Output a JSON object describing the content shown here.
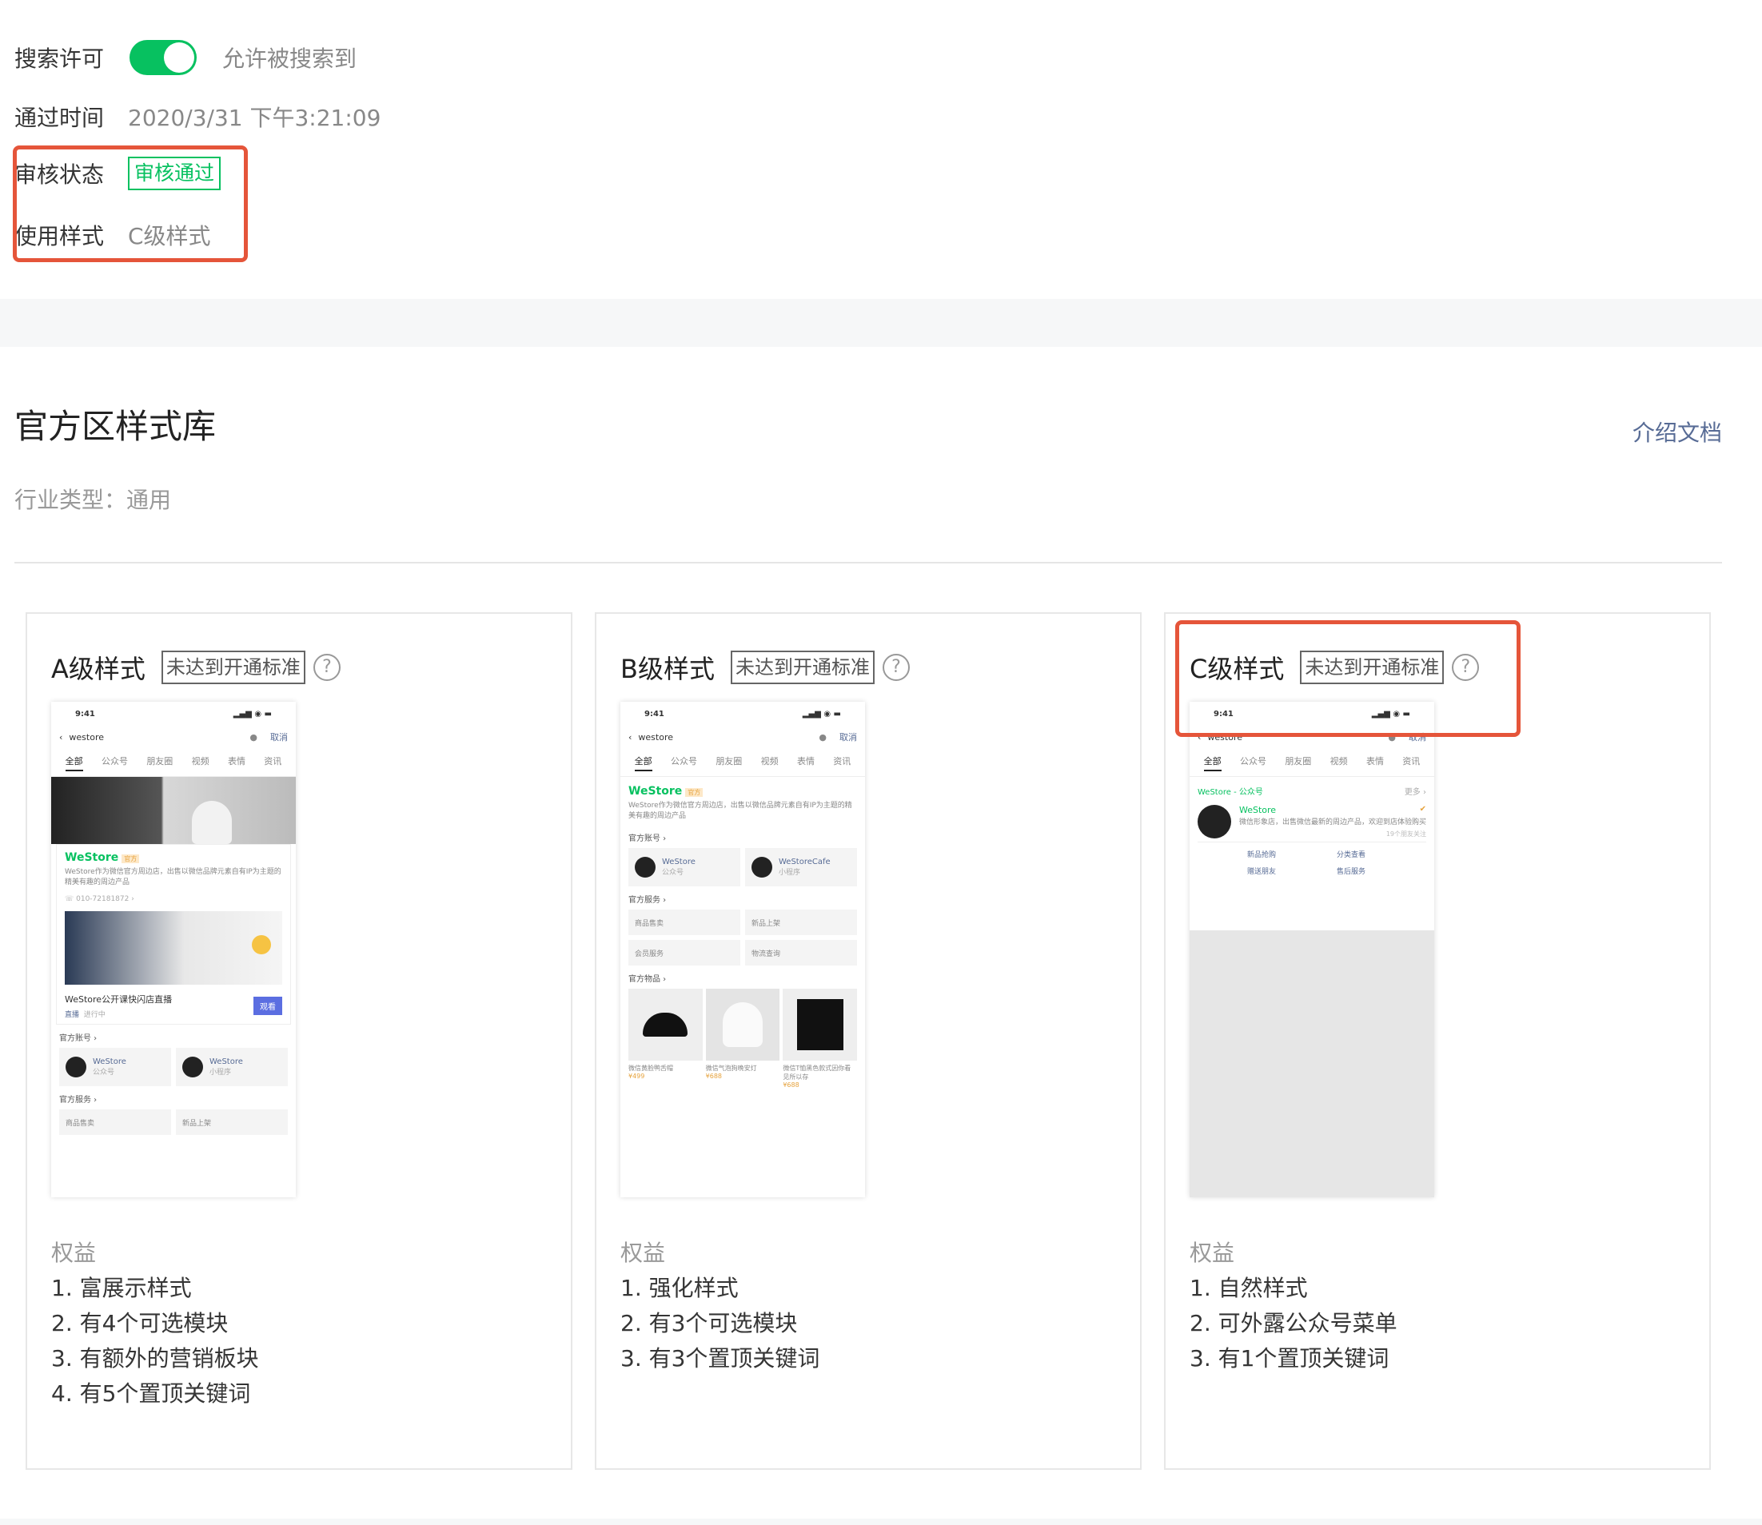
{
  "settings": {
    "search_label": "搜索许可",
    "search_value": "允许被搜索到",
    "pass_time_label": "通过时间",
    "pass_time_value": "2020/3/31 下午3:21:09",
    "review_label": "审核状态",
    "review_value": "审核通过",
    "style_label": "使用样式",
    "style_value": "C级样式"
  },
  "library": {
    "title": "官方区样式库",
    "doc_link": "介绍文档",
    "industry": "行业类型：通用"
  },
  "phone": {
    "time": "9:41",
    "query": "westore",
    "cancel": "取消",
    "tabs": [
      "全部",
      "公众号",
      "朋友圈",
      "视频",
      "表情",
      "资讯"
    ],
    "brand": "WeStore",
    "brand_tag": "官方",
    "brand_desc": "WeStore作为微信官方周边店，出售以微信品牌元素自有IP为主题的精美有趣的周边产品",
    "phone_no": "010-72181872",
    "live_title": "WeStore公开课快闪店直播",
    "live_tag": "直播",
    "live_status": "进行中",
    "live_btn": "观看",
    "acct_section": "官方账号",
    "service_section": "官方服务",
    "goods_section": "官方物品",
    "acct_a_name": "WeStore",
    "acct_a_type": "公众号",
    "acct_b_name": "WeStore",
    "acct_b_name2": "WeStoreCafe",
    "acct_b_type": "小程序",
    "svc_1": "商品售卖",
    "svc_2": "新品上架",
    "svc_3": "会员服务",
    "svc_4": "物流查询",
    "goods": [
      {
        "name": "微信黄脸鸭舌帽",
        "price": "¥499"
      },
      {
        "name": "微信气泡狗晚安灯",
        "price": "¥688"
      },
      {
        "name": "微信T恤黑色款式因你看见所以存",
        "price": "¥688"
      }
    ],
    "c_head": "WeStore - 公众号",
    "c_more": "更多",
    "c_desc": "微信形象店，出售微信最新的周边产品，欢迎到店体验购买",
    "c_followers": "19个朋友关注",
    "c_menu": [
      "新品抢购",
      "分类查看",
      "赠送朋友",
      "售后服务"
    ]
  },
  "cards": [
    {
      "title": "A级样式",
      "tag": "未达到开通标准",
      "rights_title": "权益",
      "rights": [
        "1. 富展示样式",
        "2. 有4个可选模块",
        "3. 有额外的营销板块",
        "4. 有5个置顶关键词"
      ]
    },
    {
      "title": "B级样式",
      "tag": "未达到开通标准",
      "rights_title": "权益",
      "rights": [
        "1. 强化样式",
        "2. 有3个可选模块",
        "3. 有3个置顶关键词"
      ]
    },
    {
      "title": "C级样式",
      "tag": "未达到开通标准",
      "rights_title": "权益",
      "rights": [
        "1. 自然样式",
        "2. 可外露公众号菜单",
        "3. 有1个置顶关键词"
      ]
    }
  ],
  "colors": {
    "accent": "#07c160",
    "highlight": "#e5553a",
    "link": "#576b95"
  }
}
